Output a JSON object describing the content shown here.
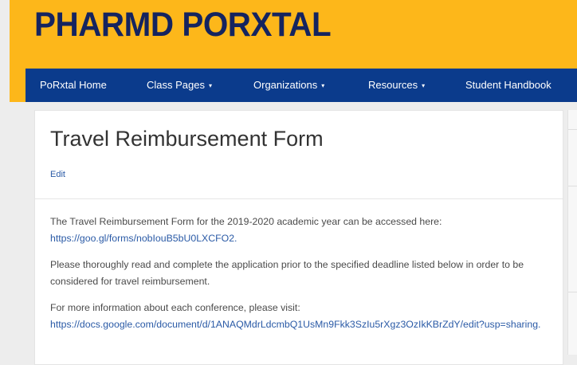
{
  "header": {
    "site_title": "PHARMD PORXTAL"
  },
  "nav": {
    "items": [
      {
        "label": "PoRxtal Home",
        "caret": ""
      },
      {
        "label": "Class Pages",
        "caret": "▾"
      },
      {
        "label": "Organizations",
        "caret": "▾"
      },
      {
        "label": "Resources",
        "caret": "▾"
      },
      {
        "label": "Student Handbook",
        "caret": ""
      }
    ]
  },
  "article": {
    "title": "Travel Reimbursement Form",
    "edit_label": "Edit",
    "p1_text": "The Travel Reimbursement Form for the 2019-2020 academic year can be accessed here:",
    "p1_link": "https://goo.gl/forms/nobIouB5bU0LXCFO2.",
    "p2_text": "Please thoroughly read and complete the application prior to the specified deadline listed below in order to be considered for travel reimbursement.",
    "p3_text": "For more information about each conference, please visit:",
    "p3_link": "https://docs.google.com/document/d/1ANAQMdrLdcmbQ1UsMn9Fkk3SzIu5rXgz3OzIkKBrZdY/edit?usp=sharing."
  },
  "colors": {
    "gold": "#fdb71a",
    "navy": "#0b3b8c",
    "title_navy": "#15245f",
    "link": "#2a5aa6"
  }
}
